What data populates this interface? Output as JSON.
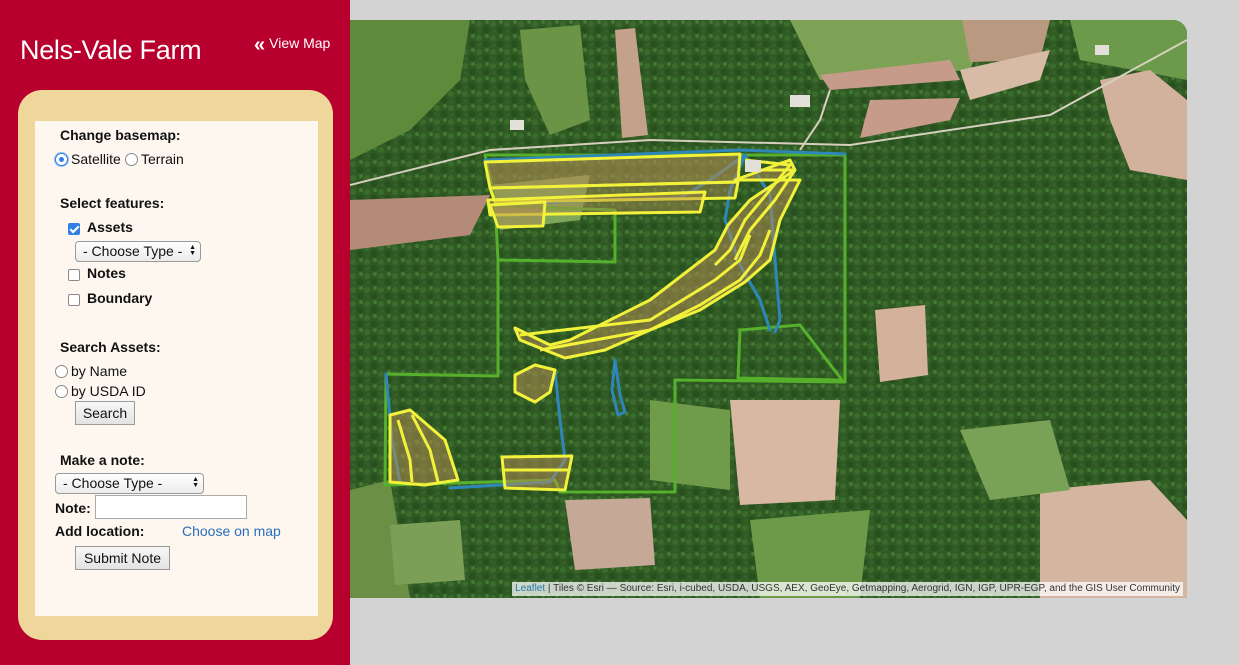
{
  "header": {
    "title": "Nels-Vale Farm",
    "view_map_label": "View Map"
  },
  "basemap": {
    "heading": "Change basemap:",
    "options": [
      {
        "label": "Satellite",
        "selected": true
      },
      {
        "label": "Terrain",
        "selected": false
      }
    ]
  },
  "features": {
    "heading": "Select features:",
    "assets_label": "Assets",
    "assets_checked": true,
    "type_select": "- Choose Type -",
    "notes_label": "Notes",
    "notes_checked": false,
    "boundary_label": "Boundary",
    "boundary_checked": false
  },
  "search": {
    "heading": "Search Assets:",
    "by_name_label": "by Name",
    "by_usda_label": "by USDA ID",
    "search_button": "Search"
  },
  "note": {
    "heading": "Make a note:",
    "type_select": "- Choose Type -",
    "note_label": "Note:",
    "note_value": "",
    "location_label": "Add location:",
    "choose_on_map": "Choose on map",
    "submit_button": "Submit Note"
  },
  "map": {
    "attribution_leaflet": "Leaflet",
    "attribution_text": " | Tiles © Esri — Source: Esri, i-cubed, USDA, USGS, AEX, GeoEye, Getmapping, Aerogrid, IGN, IGP, UPR-EGP, and the GIS User Community",
    "colors": {
      "boundary": "#4caf2a",
      "assets": "#f2f23a",
      "water": "#2f86b8",
      "forest": "#2f5a24",
      "field": "#c9a98f"
    }
  }
}
